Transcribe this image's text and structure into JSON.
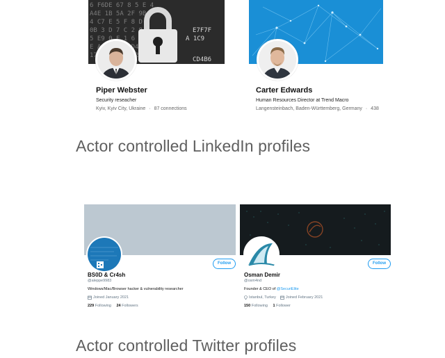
{
  "linkedin": {
    "profiles": [
      {
        "name": "Piper Webster",
        "headline": "Security reseacher",
        "location": "Kyiv, Kyiv City, Ukraine",
        "separator": "·",
        "connections": "87 connections"
      },
      {
        "name": "Carter Edwards",
        "headline": "Human Resources Director at Trend Macro",
        "location": "Langensteinbach, Baden-Württemberg, Germany",
        "separator": "·",
        "connections": "438"
      }
    ],
    "caption": "Actor controlled LinkedIn profiles"
  },
  "twitter": {
    "profiles": [
      {
        "name": "BS0D & Cr4sh",
        "handle": "@aleppe9983",
        "bio": "Windows/Mac/Browser hacker & vulnerability researcher",
        "bio_link": "",
        "location": "",
        "joined": "Joined January 2021",
        "following_count": "229",
        "following_label": "Following",
        "followers_count": "24",
        "followers_label": "Followers",
        "follow_label": "Follow",
        "avatar_text": "QR"
      },
      {
        "name": "Osman Demir",
        "handle": "@osm4nd",
        "bio": "Founder & CEO of ",
        "bio_link": "@SecuriElite",
        "location": "Istanbul, Turkey",
        "joined": "Joined February 2021",
        "following_count": "150",
        "following_label": "Following",
        "followers_count": "1",
        "followers_label": "Follower",
        "follow_label": "Follow"
      }
    ],
    "caption": "Actor controlled Twitter profiles"
  },
  "colors": {
    "twitter_blue": "#1d9bf0",
    "linkedin_banner_blue": "#1a8fd6",
    "twitter_banner_gray": "#bcc8d1",
    "caption_gray": "#5f5f5f"
  },
  "icons": {
    "calendar": "calendar-icon",
    "location": "location-pin-icon",
    "padlock": "padlock-icon"
  }
}
